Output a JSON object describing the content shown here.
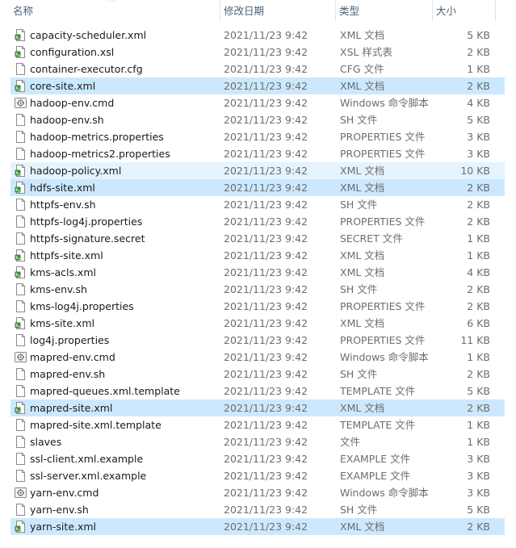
{
  "headers": {
    "name": "名称",
    "date": "修改日期",
    "type": "类型",
    "size": "大小"
  },
  "sort_indicator": "^",
  "files": [
    {
      "name": "capacity-scheduler.xml",
      "date": "2021/11/23 9:42",
      "type": "XML 文档",
      "size": "5 KB",
      "icon": "xml-file-icon",
      "state": ""
    },
    {
      "name": "configuration.xsl",
      "date": "2021/11/23 9:42",
      "type": "XSL 样式表",
      "size": "2 KB",
      "icon": "xml-file-icon",
      "state": ""
    },
    {
      "name": "container-executor.cfg",
      "date": "2021/11/23 9:42",
      "type": "CFG 文件",
      "size": "1 KB",
      "icon": "blank-file-icon",
      "state": ""
    },
    {
      "name": "core-site.xml",
      "date": "2021/11/23 9:42",
      "type": "XML 文档",
      "size": "2 KB",
      "icon": "xml-file-icon",
      "state": "selected"
    },
    {
      "name": "hadoop-env.cmd",
      "date": "2021/11/23 9:42",
      "type": "Windows 命令脚本",
      "size": "4 KB",
      "icon": "cmd-file-icon",
      "state": ""
    },
    {
      "name": "hadoop-env.sh",
      "date": "2021/11/23 9:42",
      "type": "SH 文件",
      "size": "5 KB",
      "icon": "blank-file-icon",
      "state": ""
    },
    {
      "name": "hadoop-metrics.properties",
      "date": "2021/11/23 9:42",
      "type": "PROPERTIES 文件",
      "size": "3 KB",
      "icon": "blank-file-icon",
      "state": ""
    },
    {
      "name": "hadoop-metrics2.properties",
      "date": "2021/11/23 9:42",
      "type": "PROPERTIES 文件",
      "size": "3 KB",
      "icon": "blank-file-icon",
      "state": ""
    },
    {
      "name": "hadoop-policy.xml",
      "date": "2021/11/23 9:42",
      "type": "XML 文档",
      "size": "10 KB",
      "icon": "xml-file-icon",
      "state": "hover"
    },
    {
      "name": "hdfs-site.xml",
      "date": "2021/11/23 9:42",
      "type": "XML 文档",
      "size": "2 KB",
      "icon": "xml-file-icon",
      "state": "selected"
    },
    {
      "name": "httpfs-env.sh",
      "date": "2021/11/23 9:42",
      "type": "SH 文件",
      "size": "2 KB",
      "icon": "blank-file-icon",
      "state": ""
    },
    {
      "name": "httpfs-log4j.properties",
      "date": "2021/11/23 9:42",
      "type": "PROPERTIES 文件",
      "size": "2 KB",
      "icon": "blank-file-icon",
      "state": ""
    },
    {
      "name": "httpfs-signature.secret",
      "date": "2021/11/23 9:42",
      "type": "SECRET 文件",
      "size": "1 KB",
      "icon": "blank-file-icon",
      "state": ""
    },
    {
      "name": "httpfs-site.xml",
      "date": "2021/11/23 9:42",
      "type": "XML 文档",
      "size": "1 KB",
      "icon": "xml-file-icon",
      "state": ""
    },
    {
      "name": "kms-acls.xml",
      "date": "2021/11/23 9:42",
      "type": "XML 文档",
      "size": "4 KB",
      "icon": "xml-file-icon",
      "state": ""
    },
    {
      "name": "kms-env.sh",
      "date": "2021/11/23 9:42",
      "type": "SH 文件",
      "size": "2 KB",
      "icon": "blank-file-icon",
      "state": ""
    },
    {
      "name": "kms-log4j.properties",
      "date": "2021/11/23 9:42",
      "type": "PROPERTIES 文件",
      "size": "2 KB",
      "icon": "blank-file-icon",
      "state": ""
    },
    {
      "name": "kms-site.xml",
      "date": "2021/11/23 9:42",
      "type": "XML 文档",
      "size": "6 KB",
      "icon": "xml-file-icon",
      "state": ""
    },
    {
      "name": "log4j.properties",
      "date": "2021/11/23 9:42",
      "type": "PROPERTIES 文件",
      "size": "11 KB",
      "icon": "blank-file-icon",
      "state": ""
    },
    {
      "name": "mapred-env.cmd",
      "date": "2021/11/23 9:42",
      "type": "Windows 命令脚本",
      "size": "1 KB",
      "icon": "cmd-file-icon",
      "state": ""
    },
    {
      "name": "mapred-env.sh",
      "date": "2021/11/23 9:42",
      "type": "SH 文件",
      "size": "2 KB",
      "icon": "blank-file-icon",
      "state": ""
    },
    {
      "name": "mapred-queues.xml.template",
      "date": "2021/11/23 9:42",
      "type": "TEMPLATE 文件",
      "size": "5 KB",
      "icon": "blank-file-icon",
      "state": ""
    },
    {
      "name": "mapred-site.xml",
      "date": "2021/11/23 9:42",
      "type": "XML 文档",
      "size": "2 KB",
      "icon": "xml-file-icon",
      "state": "selected"
    },
    {
      "name": "mapred-site.xml.template",
      "date": "2021/11/23 9:42",
      "type": "TEMPLATE 文件",
      "size": "1 KB",
      "icon": "blank-file-icon",
      "state": ""
    },
    {
      "name": "slaves",
      "date": "2021/11/23 9:42",
      "type": "文件",
      "size": "1 KB",
      "icon": "blank-file-icon",
      "state": ""
    },
    {
      "name": "ssl-client.xml.example",
      "date": "2021/11/23 9:42",
      "type": "EXAMPLE 文件",
      "size": "3 KB",
      "icon": "blank-file-icon",
      "state": ""
    },
    {
      "name": "ssl-server.xml.example",
      "date": "2021/11/23 9:42",
      "type": "EXAMPLE 文件",
      "size": "3 KB",
      "icon": "blank-file-icon",
      "state": ""
    },
    {
      "name": "yarn-env.cmd",
      "date": "2021/11/23 9:42",
      "type": "Windows 命令脚本",
      "size": "3 KB",
      "icon": "cmd-file-icon",
      "state": ""
    },
    {
      "name": "yarn-env.sh",
      "date": "2021/11/23 9:42",
      "type": "SH 文件",
      "size": "5 KB",
      "icon": "blank-file-icon",
      "state": ""
    },
    {
      "name": "yarn-site.xml",
      "date": "2021/11/23 9:42",
      "type": "XML 文档",
      "size": "2 KB",
      "icon": "xml-file-icon",
      "state": "selected"
    }
  ],
  "colors": {
    "selected_bg": "#cce8ff",
    "hover_bg": "#e5f3ff",
    "xml_icon_accent": "#3f8f3a",
    "header_text": "#4c607a"
  }
}
